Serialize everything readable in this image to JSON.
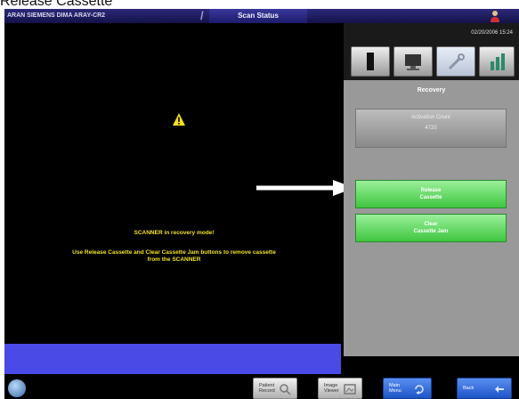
{
  "caption": "Release Cassette",
  "topbar": {
    "left_text": "ARAN SIEMENS DIMA   ARAY-CR2",
    "title": "Scan Status"
  },
  "status": {
    "timestamp": "02/20/2006 15:24"
  },
  "tabs": [
    {
      "name": "tab-scanner",
      "icon": "scanner-icon"
    },
    {
      "name": "tab-monitor",
      "icon": "monitor-icon"
    },
    {
      "name": "tab-tools",
      "icon": "wrench-icon"
    },
    {
      "name": "tab-chart",
      "icon": "chart-icon"
    }
  ],
  "recovery": {
    "title": "Recovery",
    "counter_label": "Activation Count",
    "counter_value": "4720",
    "release_label_1": "Release",
    "release_label_2": "Cassette",
    "clear_label_1": "Clear",
    "clear_label_2": "Cassette Jam"
  },
  "message": {
    "line1": "SCANNER in recovery mode!",
    "line2": "Use Release Cassette and Clear Cassette Jam buttons to remove cassette",
    "line3": "from the SCANNER"
  },
  "bottom": {
    "btn1_1": "Patient",
    "btn1_2": "Record",
    "btn2_1": "Image",
    "btn2_2": "Viewer",
    "btn3_1": "Main",
    "btn3_2": "Menu",
    "btn4": "Back"
  },
  "colors": {
    "warning_text": "#f0e020",
    "accent_green": "#3fc63f",
    "status_blue": "#4a4ae6"
  }
}
